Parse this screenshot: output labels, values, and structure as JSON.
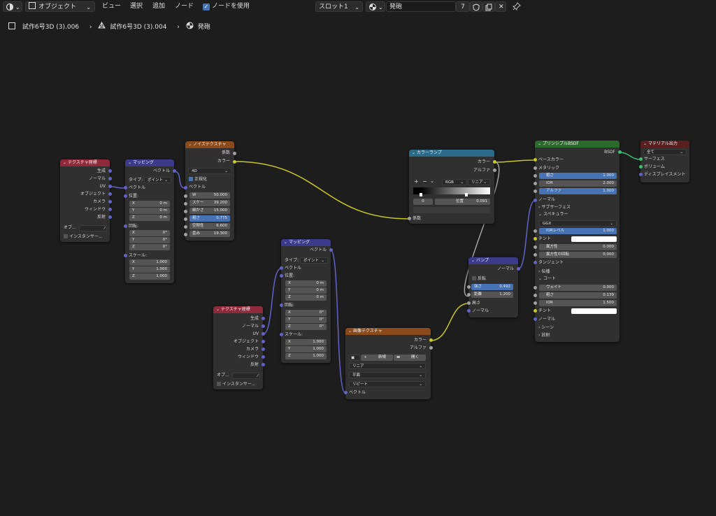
{
  "header": {
    "mode": "オブジェクト",
    "menus": [
      "ビュー",
      "選択",
      "追加",
      "ノード"
    ],
    "use_nodes_label": "ノードを使用",
    "slot": "スロット1",
    "material_name": "発砲",
    "user_count": "7"
  },
  "breadcrumb": [
    "試作6号3D (3).006",
    "試作6号3D (3).004",
    "発砲"
  ],
  "colors": {
    "yellow": "#c7c729",
    "violet": "#6363c7",
    "gray": "#a1a1a1",
    "green": "#3fbd72",
    "header_red": "#8f2a3a",
    "header_blue": "#3b3b8a",
    "header_orange": "#8a4a1a",
    "header_teal": "#2a6b8a",
    "header_green": "#2a6b2a",
    "header_dark_red": "#5a2020"
  },
  "nodes": {
    "texcoord1": {
      "title": "テクスチャ座標",
      "outputs": [
        "生成",
        "ノーマル",
        "UV",
        "オブジェクト",
        "カメラ",
        "ウィンドウ",
        "反射"
      ],
      "object_label": "オブ...",
      "instancer": "インスタンサー..."
    },
    "mapping1": {
      "title": "マッピング",
      "output": "ベクトル",
      "type_label": "タイプ:",
      "type_value": "ポイント",
      "input_vector": "ベクトル",
      "location_label": "位置:",
      "location": [
        [
          "X",
          "0 m"
        ],
        [
          "Y",
          "0 m"
        ],
        [
          "Z",
          "0 m"
        ]
      ],
      "rotation_label": "回転:",
      "rotation": [
        [
          "X",
          "0°"
        ],
        [
          "Y",
          "0°"
        ],
        [
          "Z",
          "0°"
        ]
      ],
      "scale_label": "スケール:",
      "scale": [
        [
          "X",
          "1.000"
        ],
        [
          "Y",
          "1.000"
        ],
        [
          "Z",
          "1.000"
        ]
      ]
    },
    "noise": {
      "title": "ノイズテクスチャ",
      "outputs": [
        "係数",
        "カラー"
      ],
      "dimension": "4D",
      "normalize": "正規化",
      "input_vector": "ベクトル",
      "fields": [
        [
          "W",
          "50.000"
        ],
        [
          "スケー",
          "39.200"
        ],
        [
          "細かさ",
          "15.000"
        ],
        [
          "粗さ",
          "0.775"
        ],
        [
          "空隙性",
          "6.600"
        ],
        [
          "歪み",
          "19.300"
        ]
      ]
    },
    "colorramp": {
      "title": "カラーランプ",
      "outputs": [
        "カラー",
        "アルファ"
      ],
      "plus": "+",
      "minus": "−",
      "mode": "RGB",
      "interp": "リニア",
      "index": "0",
      "pos_label": "位置",
      "pos_value": "0.091",
      "input": "係数"
    },
    "mapping2": {
      "title": "マッピング",
      "output": "ベクトル",
      "type_label": "タイプ:",
      "type_value": "ポイント",
      "input_vector": "ベクトル",
      "location_label": "位置:",
      "location": [
        [
          "X",
          "0 m"
        ],
        [
          "Y",
          "0 m"
        ],
        [
          "Z",
          "0 m"
        ]
      ],
      "rotation_label": "回転:",
      "rotation": [
        [
          "X",
          "0°"
        ],
        [
          "Y",
          "0°"
        ],
        [
          "Z",
          "0°"
        ]
      ],
      "scale_label": "スケール:",
      "scale": [
        [
          "X",
          "1.000"
        ],
        [
          "Y",
          "1.000"
        ],
        [
          "Z",
          "1.000"
        ]
      ]
    },
    "texcoord2": {
      "title": "テクスチャ座標",
      "outputs": [
        "生成",
        "ノーマル",
        "UV",
        "オブジェクト",
        "カメラ",
        "ウィンドウ",
        "反射"
      ],
      "object_label": "オブ...",
      "instancer": "インスタンサー..."
    },
    "imagetex": {
      "title": "画像テクスチャ",
      "outputs": [
        "カラー",
        "アルファ"
      ],
      "new": "新規",
      "open": "開く",
      "interpolation": "リニア",
      "projection": "平面",
      "extension": "リピート",
      "input": "ベクトル"
    },
    "bump": {
      "title": "バンプ",
      "output": "ノーマル",
      "invert": "反転",
      "fields": [
        [
          "強さ",
          "0.492"
        ],
        [
          "距離",
          "1.200"
        ]
      ],
      "inputs": [
        "高さ",
        "ノーマル"
      ]
    },
    "bsdf": {
      "title": "プリンシプルBSDF",
      "output": "BSDF",
      "base_color": "ベースカラー",
      "metallic": "メタリック",
      "roughness": [
        "粗さ",
        "1.000"
      ],
      "ior": [
        "IOR",
        "2.000"
      ],
      "alpha": [
        "アルファ",
        "1.000"
      ],
      "normal": "ノーマル",
      "subsurface": "サブサーフェス",
      "specular": "スペキュラー",
      "distribution": "GGX",
      "ior_level": [
        "IORレベル",
        "1.000"
      ],
      "tint": "チント",
      "anisotropic": [
        "異方性",
        "0.000"
      ],
      "aniso_rot": [
        "異方性の回転",
        "0.000"
      ],
      "tangent": "タンジェント",
      "transmission": "伝播",
      "coat": "コート",
      "coat_weight": [
        "ウェイト",
        "0.000"
      ],
      "coat_rough": [
        "粗さ",
        "0.139"
      ],
      "coat_ior": [
        "IOR",
        "1.500"
      ],
      "coat_tint": "チント",
      "coat_normal": "ノーマル",
      "sheen": "シーン",
      "emission": "放射"
    },
    "output": {
      "title": "マテリアル出力",
      "target": "全て",
      "inputs": [
        "サーフェス",
        "ボリューム",
        "ディスプレイスメント"
      ]
    }
  }
}
